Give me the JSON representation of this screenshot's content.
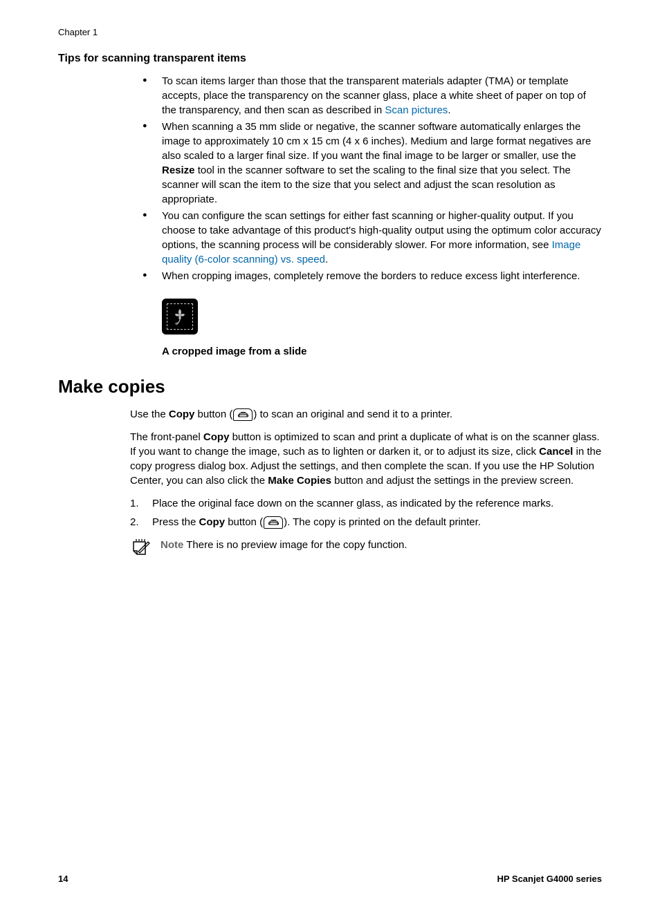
{
  "chapter": "Chapter 1",
  "sections": {
    "tips": {
      "heading": "Tips for scanning transparent items",
      "bullets": {
        "b1_a": "To scan items larger than those that the transparent materials adapter (TMA) or template accepts, place the transparency on the scanner glass, place a white sheet of paper on top of the transparency, and then scan as described in ",
        "b1_link": "Scan pictures",
        "b1_b": ".",
        "b2_a": "When scanning a 35 mm slide or negative, the scanner software automatically enlarges the image to approximately 10 cm x 15 cm (4 x 6 inches). Medium and large format negatives are also scaled to a larger final size. If you want the final image to be larger or smaller, use the ",
        "b2_bold": "Resize",
        "b2_b": " tool in the scanner software to set the scaling to the final size that you select. The scanner will scan the item to the size that you select and adjust the scan resolution as appropriate.",
        "b3_a": "You can configure the scan settings for either fast scanning or higher-quality output. If you choose to take advantage of this product's high-quality output using the optimum color accuracy options, the scanning process will be considerably slower. For more information, see ",
        "b3_link": "Image quality (6-color scanning) vs. speed",
        "b3_b": ".",
        "b4": "When cropping images, completely remove the borders to reduce excess light interference."
      },
      "caption": "A cropped image from a slide"
    },
    "make_copies": {
      "heading": "Make copies",
      "p1_a": "Use the ",
      "p1_bold1": "Copy",
      "p1_b": " button (",
      "p1_c": ") to scan an original and send it to a printer.",
      "p2_a": "The front-panel ",
      "p2_bold1": "Copy",
      "p2_b": " button is optimized to scan and print a duplicate of what is on the scanner glass. If you want to change the image, such as to lighten or darken it, or to adjust its size, click ",
      "p2_bold2": "Cancel",
      "p2_c": " in the copy progress dialog box. Adjust the settings, and then complete the scan. If you use the HP Solution Center, you can also click the ",
      "p2_bold3": "Make Copies",
      "p2_d": " button and adjust the settings in the preview screen.",
      "steps": {
        "s1_num": "1.",
        "s1": "Place the original face down on the scanner glass, as indicated by the reference marks.",
        "s2_num": "2.",
        "s2_a": "Press the ",
        "s2_bold": "Copy",
        "s2_b": " button (",
        "s2_c": "). The copy is printed on the default printer."
      },
      "note_label": "Note",
      "note_text": " There is no preview image for the copy function."
    }
  },
  "footer": {
    "page": "14",
    "product": "HP Scanjet G4000 series"
  }
}
